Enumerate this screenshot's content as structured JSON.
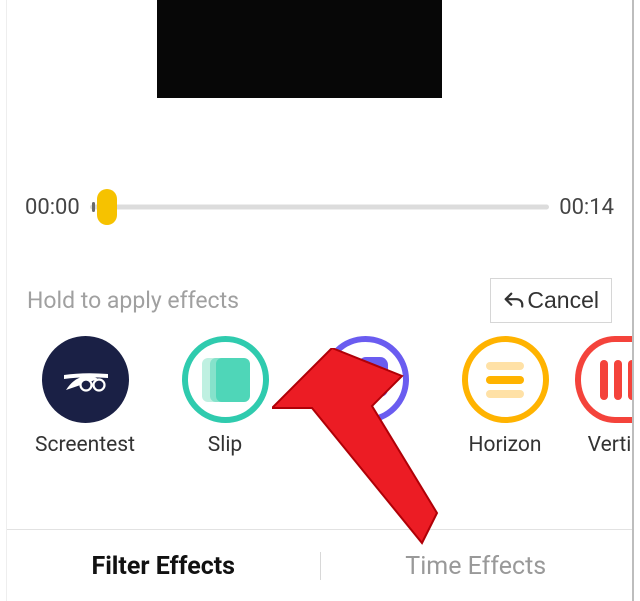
{
  "timeline": {
    "start": "00:00",
    "end": "00:14"
  },
  "hint": "Hold to apply effects",
  "cancel": "Cancel",
  "effects": [
    {
      "label": "Screentest"
    },
    {
      "label": "Slip"
    },
    {
      "label": ""
    },
    {
      "label": "Horizon"
    },
    {
      "label": "Vertic"
    }
  ],
  "tabs": {
    "filter": "Filter Effects",
    "time": "Time Effects"
  }
}
